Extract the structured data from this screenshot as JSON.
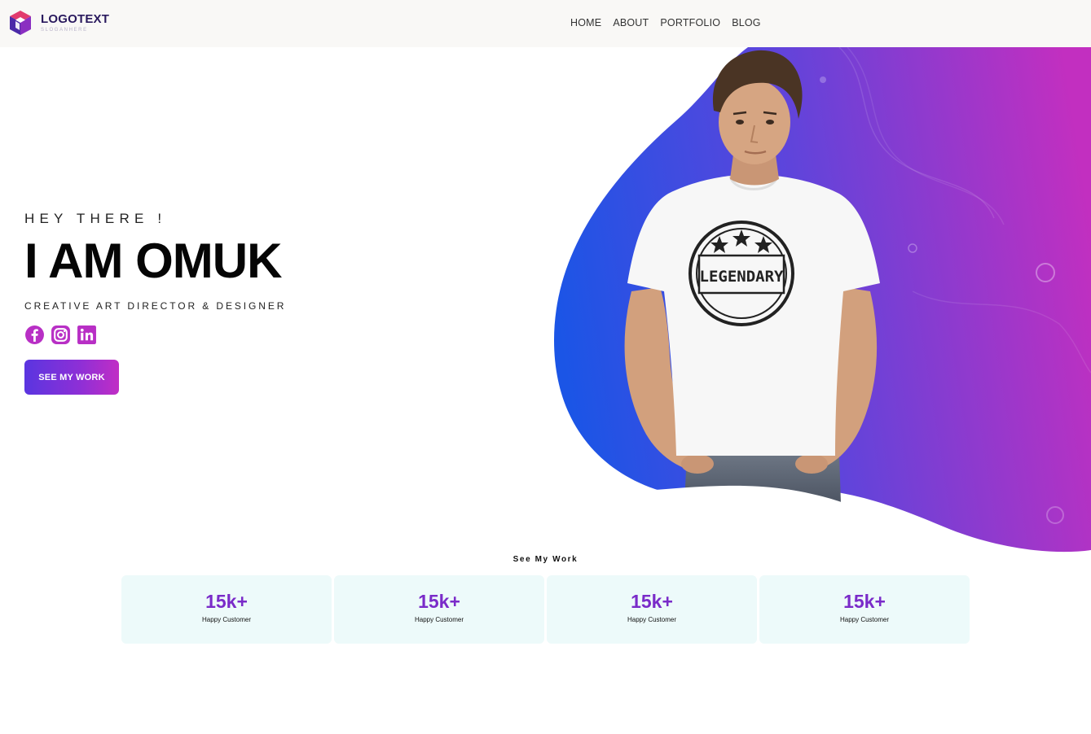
{
  "brand": {
    "name": "LOGOTEXT",
    "slogan": "SLOGANHERE",
    "icon": "cube-logo-icon"
  },
  "nav": {
    "items": [
      {
        "label": "HOME"
      },
      {
        "label": "ABOUT"
      },
      {
        "label": "PORTFOLIO"
      },
      {
        "label": "BLOG"
      }
    ]
  },
  "hero": {
    "greeting": "HEY THERE !",
    "title": "I AM OMUK",
    "subtitle": "CREATIVE ART DIRECTOR & DESIGNER",
    "tshirt_text": "LEGENDARY",
    "socials": [
      {
        "icon": "facebook-icon"
      },
      {
        "icon": "instagram-icon"
      },
      {
        "icon": "linkedin-icon"
      }
    ],
    "cta_label": "SEE MY WORK"
  },
  "stats": {
    "section_label": "See My Work",
    "cards": [
      {
        "value": "15k+",
        "label": "Happy Customer"
      },
      {
        "value": "15k+",
        "label": "Happy Customer"
      },
      {
        "value": "15k+",
        "label": "Happy Customer"
      },
      {
        "value": "15k+",
        "label": "Happy Customer"
      }
    ]
  },
  "colors": {
    "accent_purple": "#7a2bc9",
    "gradient_blue": "#1b4fe4",
    "gradient_magenta": "#c22fc0",
    "card_bg": "#edfafa",
    "navbar_bg": "#f9f8f6"
  }
}
